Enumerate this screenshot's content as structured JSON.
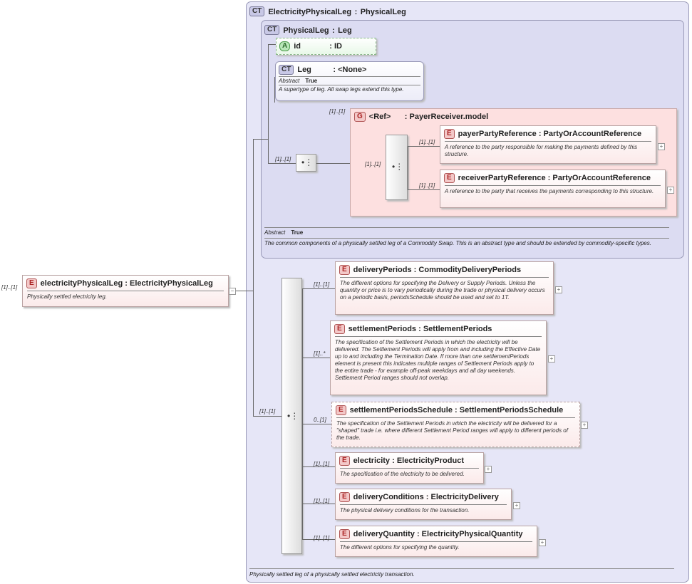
{
  "root": {
    "multiplicity": "[1]..[1]",
    "badge": "E",
    "name": "electricityPhysicalLeg",
    "type": "ElectricityPhysicalLeg",
    "description": "Physically settled electricity leg."
  },
  "ct_outer": {
    "badge": "CT",
    "name": "ElectricityPhysicalLeg",
    "base": "PhysicalLeg",
    "description": "Physically settled leg of a physically settled electricity transaction."
  },
  "ct_inner": {
    "badge": "CT",
    "name": "PhysicalLeg",
    "base": "Leg",
    "abstract_label": "Abstract",
    "abstract_value": "True",
    "description": "The common components of a physically settled leg of a Commodity Swap. This is an abstract type and should be extended by commodity-specific types."
  },
  "attr_id": {
    "badge": "A",
    "name": "id",
    "type": "ID"
  },
  "ct_leg": {
    "badge": "CT",
    "name": "Leg",
    "type": "<None>",
    "abstract_label": "Abstract",
    "abstract_value": "True",
    "description": "A supertype of leg. All swap legs extend this type."
  },
  "group": {
    "multiplicity": "[1]..[1]",
    "badge": "G",
    "name": "<Ref>",
    "type": "PayerReceiver.model",
    "seq_mult": "[1]..[1]",
    "inner_seq_mult": "[1]..[1]",
    "items": [
      {
        "mult": "[1]..[1]",
        "badge": "E",
        "name": "payerPartyReference",
        "type": "PartyOrAccountReference",
        "description": "A reference to the party responsible for making the payments defined by this structure."
      },
      {
        "mult": "[1]..[1]",
        "badge": "E",
        "name": "receiverPartyReference",
        "type": "PartyOrAccountReference",
        "description": "A reference to the party that receives the payments corresponding to this structure."
      }
    ]
  },
  "main_seq_mult": "[1]..[1]",
  "elements": [
    {
      "mult": "[1]..[1]",
      "badge": "E",
      "name": "deliveryPeriods",
      "type": "CommodityDeliveryPeriods",
      "description": "The different options for specifying the Delivery or Supply Periods. Unless the quantity or price is to vary periodically during the trade or physical delivery occurs on a periodic basis, periodsSchedule should be used and set to 1T."
    },
    {
      "mult": "[1]..*",
      "badge": "E",
      "name": "settlementPeriods",
      "type": "SettlementPeriods",
      "description": "The specification of the Settlement Periods in which the electricity will be delivered. The Settlement Periods will apply from and including the Effective Date up to and including the Termination Date. If more than one settlementPeriods element is present this indicates multiple ranges of Settlement Periods apply to the entire trade - for example off-peak weekdays and all day weekends. Settlement Period ranges should not overlap."
    },
    {
      "mult": "0..[1]",
      "badge": "E",
      "name": "settlementPeriodsSchedule",
      "type": "SettlementPeriodsSchedule",
      "description": "The specification of the Settlement Periods in which the electricity will be delivered for a \"shaped\" trade i.e. where different Settlement Period ranges will apply to different periods of the trade."
    },
    {
      "mult": "[1]..[1]",
      "badge": "E",
      "name": "electricity",
      "type": "ElectricityProduct",
      "description": "The specification of the electricity to be delivered."
    },
    {
      "mult": "[1]..[1]",
      "badge": "E",
      "name": "deliveryConditions",
      "type": "ElectricityDelivery",
      "description": "The physical delivery conditions for the transaction."
    },
    {
      "mult": "[1]..[1]",
      "badge": "E",
      "name": "deliveryQuantity",
      "type": "ElectricityPhysicalQuantity",
      "description": "The different options for specifying the quantity."
    }
  ],
  "symbols": {
    "expand": "+",
    "collapse": "−",
    "sequence": "sequence-icon",
    "separator": ":"
  }
}
